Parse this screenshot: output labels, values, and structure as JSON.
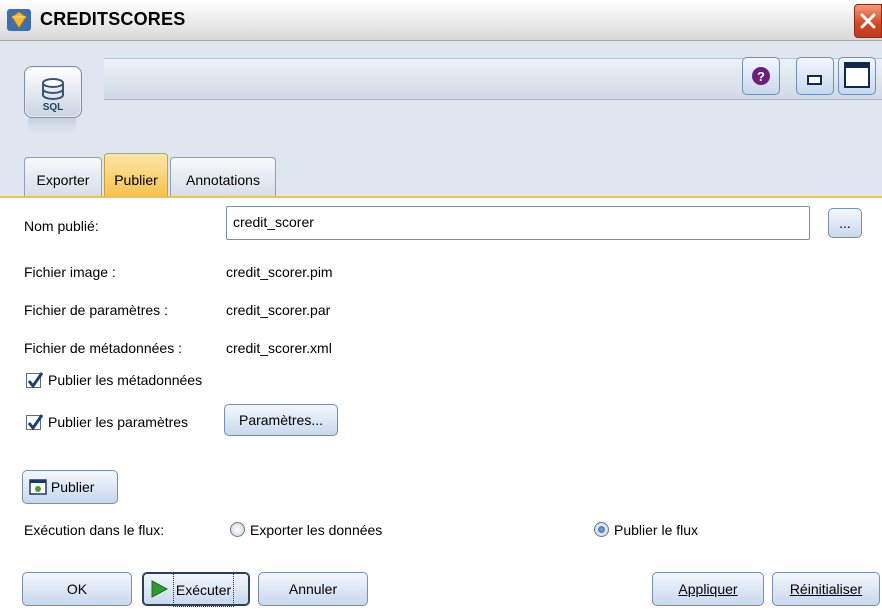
{
  "window": {
    "title": "CREDITSCORES",
    "close_icon": "close-icon"
  },
  "node": {
    "icon": "database-sql-icon",
    "icon_text": "SQL"
  },
  "header_buttons": [
    {
      "icon": "help-icon"
    },
    {
      "icon": "minimize-icon"
    },
    {
      "icon": "maximize-icon"
    }
  ],
  "tabs": [
    {
      "label": "Exporter",
      "active": false
    },
    {
      "label": "Publier",
      "active": true
    },
    {
      "label": "Annotations",
      "active": false
    }
  ],
  "form": {
    "published_name_label": "Nom publié:",
    "published_name_value": "credit_scorer",
    "browse_label": "...",
    "image_file_label": "Fichier image :",
    "image_file_value": "credit_scorer.pim",
    "param_file_label": "Fichier de paramètres :",
    "param_file_value": "credit_scorer.par",
    "meta_file_label": "Fichier de métadonnées :",
    "meta_file_value": "credit_scorer.xml",
    "publish_metadata_label": "Publier les métadonnées",
    "publish_metadata_checked": true,
    "publish_params_label": "Publier les paramètres",
    "publish_params_checked": true,
    "params_button": "Paramètres...",
    "publish_button": "Publier",
    "execution_label": "Exécution dans le flux:",
    "radio_export_label": "Exporter les données",
    "radio_publish_label": "Publier le flux",
    "selected_execution": "Publier le flux"
  },
  "footer": {
    "ok": "OK",
    "execute": "Exécuter",
    "cancel": "Annuler",
    "apply": "Appliquer",
    "reset": "Réinitialiser"
  },
  "colors": {
    "tab_active": "#f7c24c",
    "header_bg": "#dfe6ef",
    "run_green": "#2e9d2e"
  }
}
